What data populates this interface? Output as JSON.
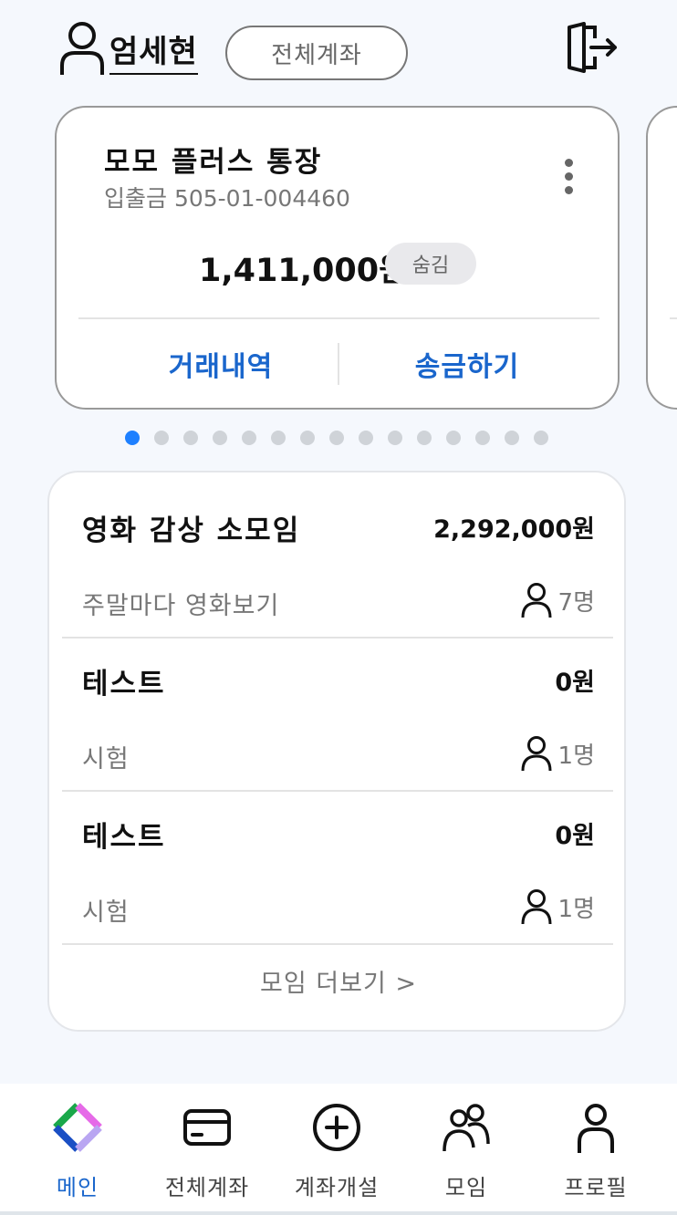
{
  "header": {
    "user_name": "엄세현",
    "all_accounts_button": "전체계좌"
  },
  "account": {
    "name": "모모 플러스 통장",
    "type_and_number": "입출금 505-01-004460",
    "balance": "1,411,000원",
    "hide_label": "숨김",
    "history_label": "거래내역",
    "transfer_label": "송금하기"
  },
  "pagination": {
    "total": 15,
    "active_index": 0
  },
  "groups": {
    "items": [
      {
        "name": "영화 감상 소모임",
        "amount": "2,292,000원",
        "description": "주말마다 영화보기",
        "members": "7명"
      },
      {
        "name": "테스트",
        "amount": "0원",
        "description": "시험",
        "members": "1명"
      },
      {
        "name": "테스트",
        "amount": "0원",
        "description": "시험",
        "members": "1명"
      }
    ],
    "more_label": "모임 더보기 >"
  },
  "nav": {
    "items": [
      {
        "label": "메인",
        "icon": "logo-icon",
        "active": true
      },
      {
        "label": "전체계좌",
        "icon": "card-icon",
        "active": false
      },
      {
        "label": "계좌개설",
        "icon": "plus-circle-icon",
        "active": false
      },
      {
        "label": "모임",
        "icon": "group-icon",
        "active": false
      },
      {
        "label": "프로필",
        "icon": "profile-icon",
        "active": false
      }
    ]
  },
  "colors": {
    "accent": "#1a66cc",
    "active_dot": "#1e80ff",
    "inactive_dot": "#cfd3d8",
    "background": "#f5f8fd"
  }
}
